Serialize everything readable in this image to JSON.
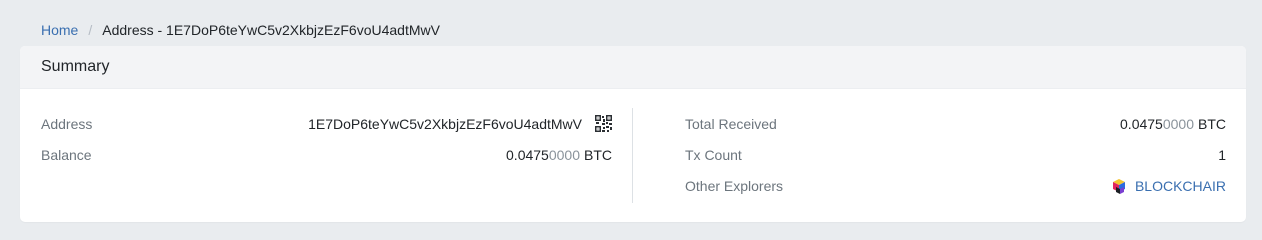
{
  "breadcrumb": {
    "home": "Home",
    "separator": "/",
    "current": "Address - 1E7DoP6teYwC5v2XkbjzEzF6voU4adtMwV"
  },
  "summary": {
    "title": "Summary",
    "left": {
      "address_label": "Address",
      "address_value": "1E7DoP6teYwC5v2XkbjzEzF6voU4adtMwV",
      "balance_label": "Balance",
      "balance_sig": "0.0475",
      "balance_dim": "0000",
      "balance_unit": "BTC"
    },
    "right": {
      "total_received_label": "Total Received",
      "total_received_sig": "0.0475",
      "total_received_dim": "0000",
      "total_received_unit": "BTC",
      "tx_count_label": "Tx Count",
      "tx_count_value": "1",
      "other_explorers_label": "Other Explorers",
      "explorer_link": "BLOCKCHAIR"
    }
  },
  "icons": {
    "qr": "qr-code-icon",
    "explorer": "blockchair-logo-icon"
  },
  "colors": {
    "link": "#3a6fb0",
    "page_bg": "#e9ecef",
    "header_bg": "#f3f4f6"
  }
}
